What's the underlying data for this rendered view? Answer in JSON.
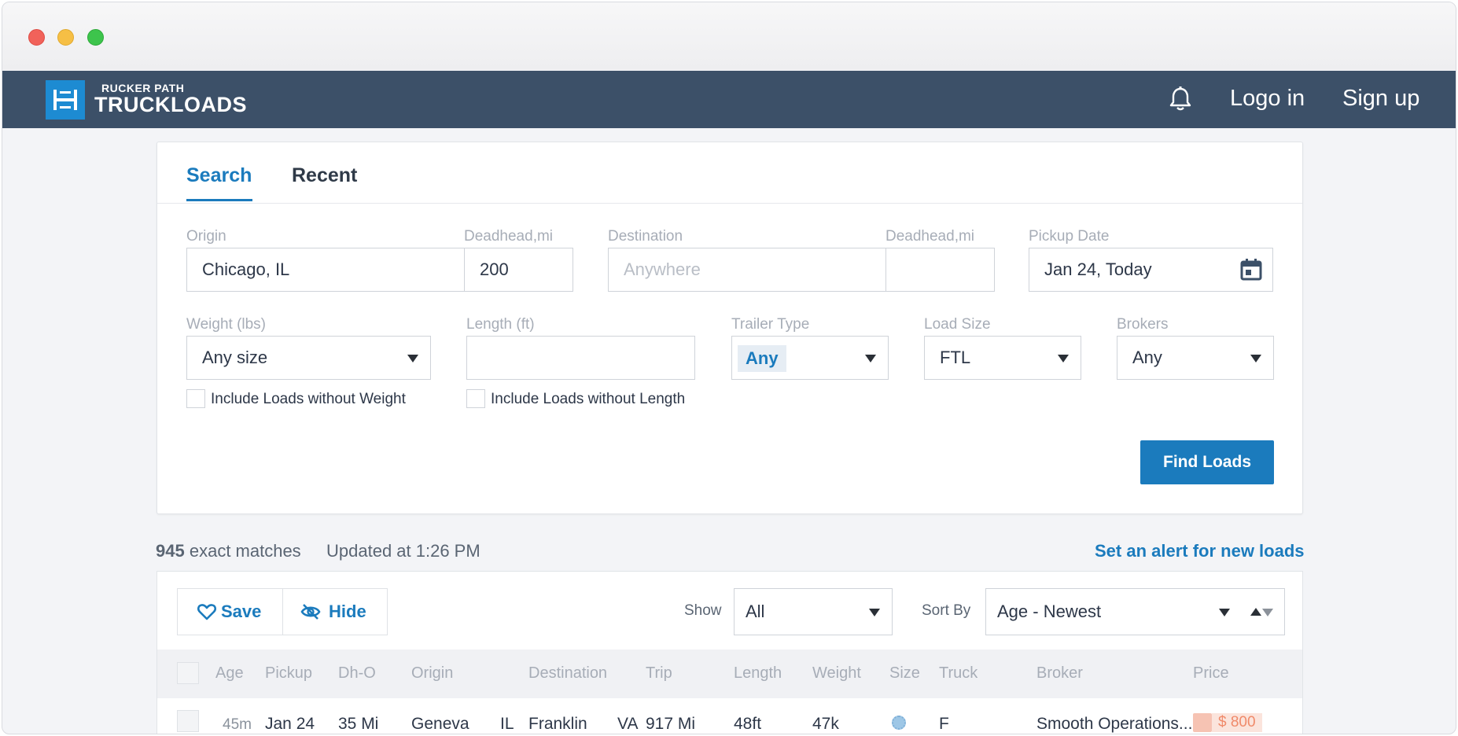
{
  "brand": {
    "small": "RUCKER PATH",
    "big": "TRUCKLOADS"
  },
  "nav": {
    "login": "Logo in",
    "signup": "Sign up"
  },
  "tabs": {
    "search": "Search",
    "recent": "Recent"
  },
  "search": {
    "origin": {
      "label": "Origin",
      "value": "Chicago, IL"
    },
    "deadhead1": {
      "label": "Deadhead,mi",
      "value": "200"
    },
    "destination": {
      "label": "Destination",
      "placeholder": "Anywhere"
    },
    "deadhead2": {
      "label": "Deadhead,mi",
      "value": ""
    },
    "pickup": {
      "label": "Pickup Date",
      "value": "Jan 24, Today"
    },
    "weight": {
      "label": "Weight (lbs)",
      "value": "Any size",
      "include": "Include Loads without Weight"
    },
    "length": {
      "label": "Length (ft)",
      "value": "",
      "include": "Include Loads without Length"
    },
    "trailer": {
      "label": "Trailer Type",
      "value": "Any"
    },
    "loadsize": {
      "label": "Load Size",
      "value": "FTL"
    },
    "brokers": {
      "label": "Brokers",
      "value": "Any"
    },
    "find_button": "Find Loads"
  },
  "results": {
    "count": "945",
    "count_suffix": "exact matches",
    "updated": "Updated at 1:26 PM",
    "alert_link": "Set an alert for new loads",
    "save": "Save",
    "hide": "Hide",
    "show_label": "Show",
    "show_value": "All",
    "sort_label": "Sort By",
    "sort_value": "Age - Newest",
    "columns": [
      "Age",
      "Pickup",
      "Dh-O",
      "Origin",
      "Destination",
      "Trip",
      "Length",
      "Weight",
      "Size",
      "Truck",
      "Broker",
      "Price"
    ],
    "rows": [
      {
        "age": "45m",
        "pickup": "Jan 24",
        "dho": "35 Mi",
        "origin_city": "Geneva",
        "origin_state": "IL",
        "dest_city": "Franklin",
        "dest_state": "VA",
        "trip": "917 Mi",
        "length": "48ft",
        "weight": "47k",
        "truck": "F",
        "broker": "Smooth Operations...",
        "price": "$ 800"
      }
    ]
  },
  "colors": {
    "navbar": "#3c5068",
    "accent": "#1b7bbd",
    "logo": "#1d8bd2"
  },
  "icons": [
    "bell-icon",
    "calendar-icon",
    "heart-icon",
    "eye-slash-icon",
    "caret-down-icon",
    "sort-direction-icon",
    "size-indicator-icon",
    "price-icon"
  ]
}
